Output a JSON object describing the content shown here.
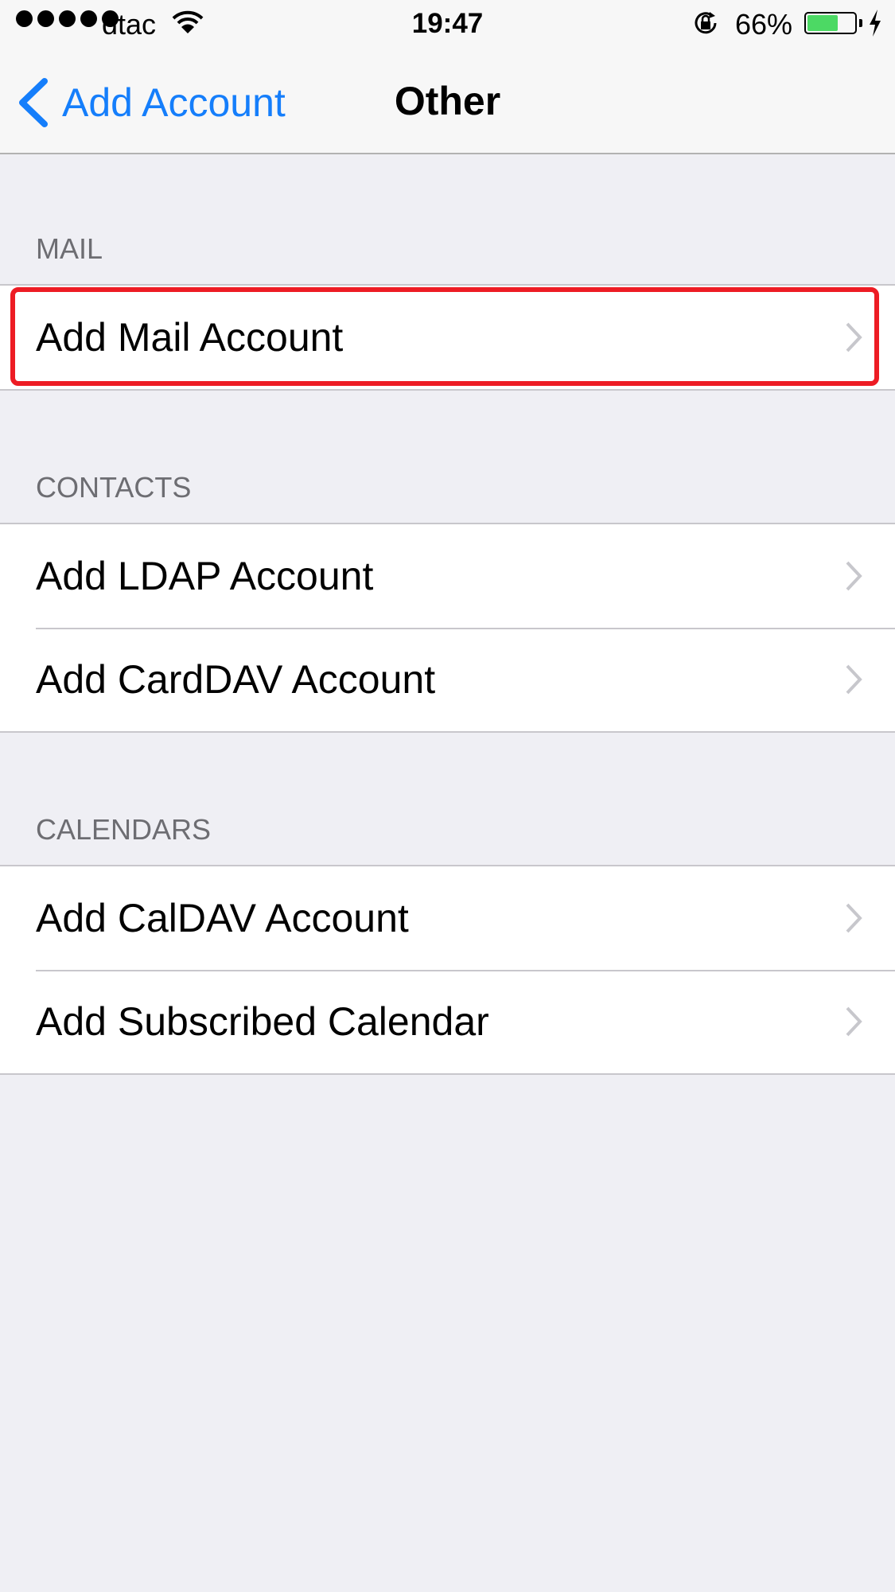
{
  "status_bar": {
    "signal_bars": 5,
    "carrier": "dtac",
    "wifi_icon": "wifi-icon",
    "time": "19:47",
    "rotation_lock_icon": "rotation-lock-icon",
    "battery_percent_text": "66%",
    "battery_level": 0.66,
    "charging_icon": "bolt-icon",
    "battery_color": "#4cd964"
  },
  "nav": {
    "back_label": "Add Account",
    "back_icon": "chevron-left-icon",
    "title": "Other",
    "accent_color": "#157efb"
  },
  "sections": [
    {
      "header": "MAIL",
      "items": [
        {
          "label": "Add Mail Account",
          "highlighted": true
        }
      ]
    },
    {
      "header": "CONTACTS",
      "items": [
        {
          "label": "Add LDAP Account"
        },
        {
          "label": "Add CardDAV Account"
        }
      ]
    },
    {
      "header": "CALENDARS",
      "items": [
        {
          "label": "Add CalDAV Account"
        },
        {
          "label": "Add Subscribed Calendar"
        }
      ]
    }
  ],
  "highlight_color": "#ed1c24"
}
